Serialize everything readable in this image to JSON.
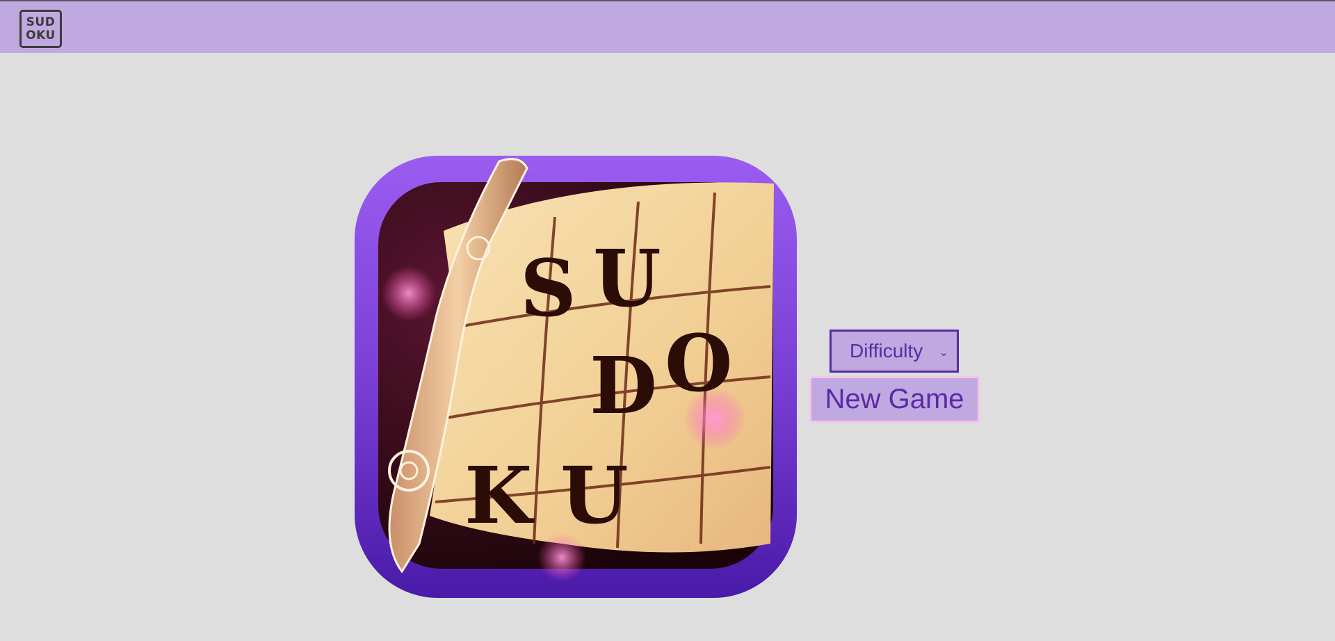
{
  "header": {
    "logo_line1": "SUD",
    "logo_line2": "OKU"
  },
  "hero": {
    "letters": [
      "S",
      "U",
      "D",
      "O",
      "K",
      "U"
    ],
    "frame_color": "#7a3fd6",
    "paper_color": "#f3d9a6"
  },
  "controls": {
    "difficulty_label": "Difficulty",
    "new_game_label": "New Game"
  },
  "colors": {
    "topbar": "#bfa9e0",
    "background": "#dedede",
    "accent": "#5a2aa6",
    "button_border": "#f6c4e8"
  }
}
